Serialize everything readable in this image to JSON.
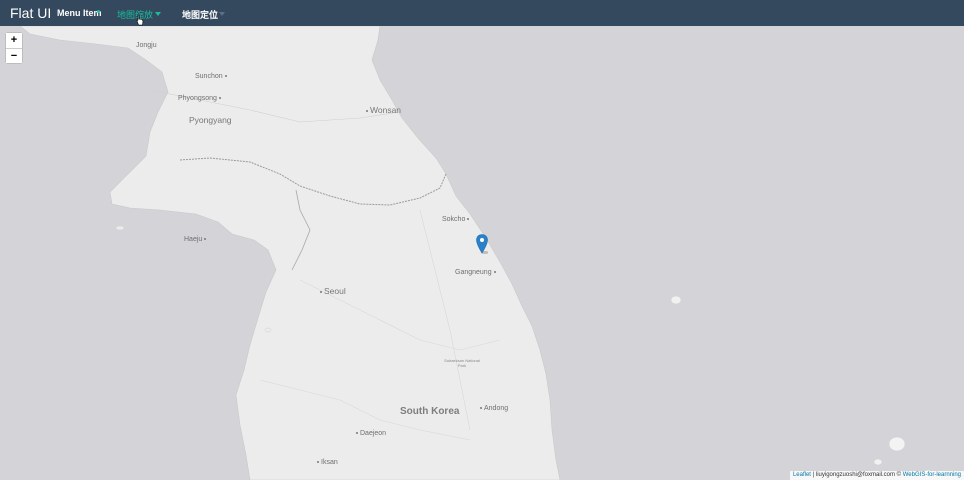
{
  "navbar": {
    "brand": "Flat UI",
    "items": [
      {
        "label": "Menu Item",
        "active": false
      },
      {
        "label": "地图缩放",
        "active": true
      },
      {
        "label": "地图定位",
        "active": false
      }
    ]
  },
  "zoom": {
    "in": "+",
    "out": "−"
  },
  "map": {
    "places": {
      "jongju": "Jongju",
      "sunchon": "Sunchon",
      "phyongsong": "Phyongsong",
      "pyongyang": "Pyongyang",
      "wonsan": "Wonsan",
      "sokcho": "Sokcho",
      "haeju": "Haeju",
      "gangneung": "Gangneung",
      "seoul": "Seoul",
      "sobaeksan": "Sobaeksan National Park",
      "south_korea": "South Korea",
      "andong": "Andong",
      "daejeon": "Daejeon",
      "iksan": "Iksan"
    }
  },
  "attribution": {
    "leaflet": "Leaflet",
    "separator": " | ",
    "text": "liuyigongzuoshi@foxmail.com © ",
    "link": "WebGIS-for-learnning"
  },
  "colors": {
    "navbar": "#34495e",
    "accent": "#1abc9c",
    "land": "#ececec",
    "sea": "#d4d4d8",
    "marker": "#2a81cb"
  }
}
